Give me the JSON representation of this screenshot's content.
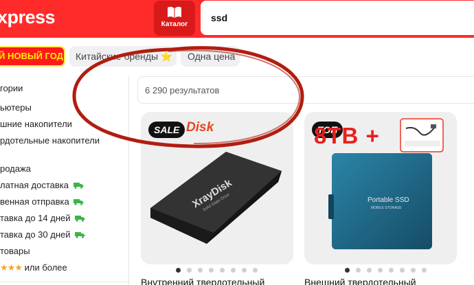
{
  "header": {
    "logo": "xpress",
    "catalog_label": "Каталог",
    "search_value": "ssd"
  },
  "chips": {
    "new_year": "Й НОВЫЙ ГОД",
    "brands": "Китайские бренды",
    "one_price": "Одна цена"
  },
  "sidebar": {
    "items": [
      "гории",
      "ьютеры",
      "шние накопители",
      "рдотельные накопители",
      "родажа",
      "латная доставка",
      "венная отправка",
      "тавка до 14 дней",
      "тавка до 30 дней",
      "товары",
      "или более"
    ]
  },
  "results": {
    "count": "6 290 результатов"
  },
  "products": [
    {
      "badge": "SALE",
      "logo_text": "Disk",
      "product_label": "XrayDisk",
      "product_sublabel": "Solid State Drive",
      "title": "Внутренний твердотельный",
      "image_index": 0,
      "image_count": 8
    },
    {
      "badge": "ТОП",
      "big_text": "8TB +",
      "product_label": "Portable SSD",
      "product_sublabel": "MOBILE STORAGE",
      "title": "Внешний твердотельный",
      "image_index": 0,
      "image_count": 8
    }
  ],
  "colors": {
    "brand_red": "#ff2b2b",
    "annotation": "#b01e10"
  }
}
